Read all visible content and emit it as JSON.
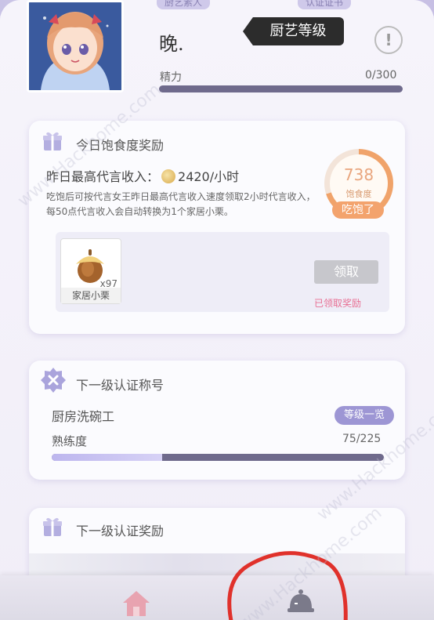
{
  "header": {
    "top_tab_left": "厨艺素人",
    "top_tab_right": "认证证书",
    "player_name": "晚.",
    "level_badge": "厨艺等级",
    "info_label": "!",
    "energy_label": "精力",
    "energy_value": "0/300",
    "energy_fraction": 0
  },
  "satiety_reward": {
    "title": "今日饱食度奖励",
    "yesterday_label": "昨日最高代言收入：",
    "yesterday_value": "2420/小时",
    "description": "吃饱后可按代言女王昨日最高代言收入速度领取2小时代言收入，每50点代言收入会自动转换为1个家居小栗。",
    "satiety_value": "738",
    "satiety_label": "饱食度",
    "eat_button": "吃饱了",
    "item_count": "x97",
    "item_name": "家居小栗",
    "claim_button": "领取",
    "claimed_text": "已领取奖励"
  },
  "next_title": {
    "title": "下一级认证称号",
    "title_name": "厨房洗碗工",
    "level_list_button": "等级一览",
    "skill_label": "熟练度",
    "skill_value": "75/225",
    "skill_fraction": 0.333
  },
  "next_reward": {
    "title": "下一级认证奖励"
  },
  "watermark": {
    "text_1": "www.Hackhome.com",
    "text_2": "www.Hackhome.com",
    "text_3": "www.Hackhome.com"
  },
  "colors": {
    "accent_purple": "#9d96d4",
    "satiety_orange": "#f3a36d",
    "claimed_pink": "#e86f93",
    "bar_track": "#6f6a8c",
    "annotation_red": "#e0312b"
  },
  "icons": {
    "gift": "gift-icon",
    "badge": "x-badge-icon",
    "coin": "coin-icon",
    "acorn": "acorn-icon",
    "home": "home-icon",
    "chef": "chef-bell-icon"
  }
}
